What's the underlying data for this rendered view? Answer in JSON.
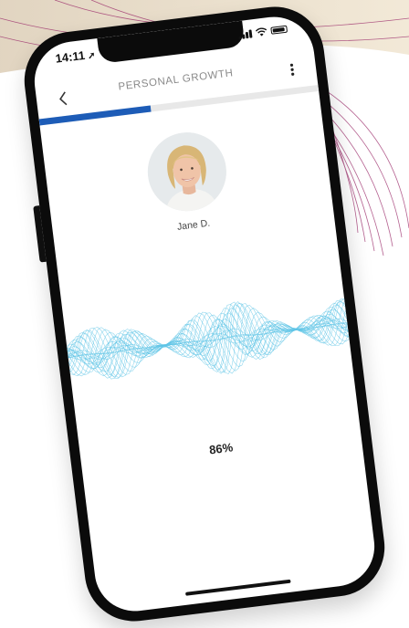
{
  "status_bar": {
    "time": "14:11",
    "location_icon": "location-arrow-icon"
  },
  "header": {
    "back_icon": "chevron-left-icon",
    "title": "PERSONAL GROWTH",
    "menu_icon": "more-vertical-icon"
  },
  "progress": {
    "fraction": 0.4
  },
  "profile": {
    "name": "Jane D."
  },
  "score": {
    "value": "86%"
  },
  "colors": {
    "accent_blue": "#1d5cb7",
    "wave_cyan": "#5ec4e6",
    "background_mesh": "#9b2b6a"
  }
}
